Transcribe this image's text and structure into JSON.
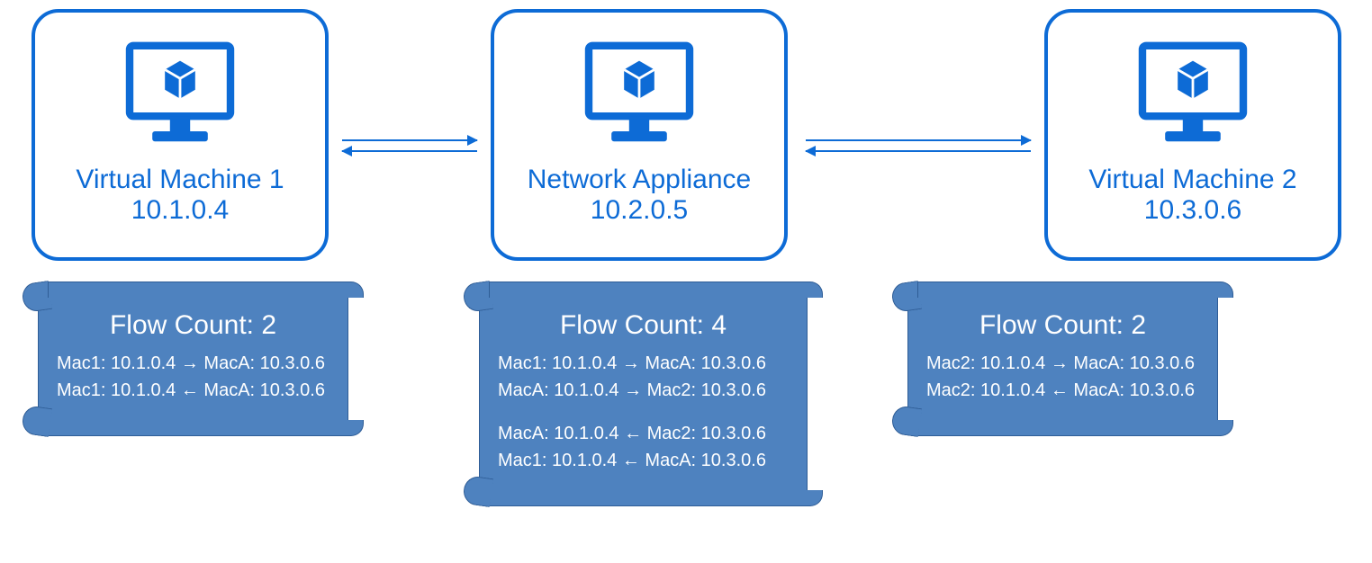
{
  "node1": {
    "title": "Virtual Machine 1",
    "ip": "10.1.0.4"
  },
  "node2": {
    "title": "Network Appliance",
    "ip": "10.2.0.5"
  },
  "node3": {
    "title": "Virtual Machine 2",
    "ip": "10.3.0.6"
  },
  "flow1": {
    "title": "Flow Count: 2",
    "lines": [
      "Mac1: 10.1.0.4 → MacA: 10.3.0.6",
      "Mac1: 10.1.0.4 ← MacA: 10.3.0.6"
    ]
  },
  "flow2": {
    "title": "Flow Count: 4",
    "lines_a": [
      "Mac1: 10.1.0.4 → MacA: 10.3.0.6",
      "MacA: 10.1.0.4 → Mac2: 10.3.0.6"
    ],
    "lines_b": [
      "MacA: 10.1.0.4 ← Mac2: 10.3.0.6",
      "Mac1: 10.1.0.4 ← MacA: 10.3.0.6"
    ]
  },
  "flow3": {
    "title": "Flow Count: 2",
    "lines": [
      "Mac2: 10.1.0.4 → MacA: 10.3.0.6",
      "Mac2: 10.1.0.4 ← MacA: 10.3.0.6"
    ]
  }
}
